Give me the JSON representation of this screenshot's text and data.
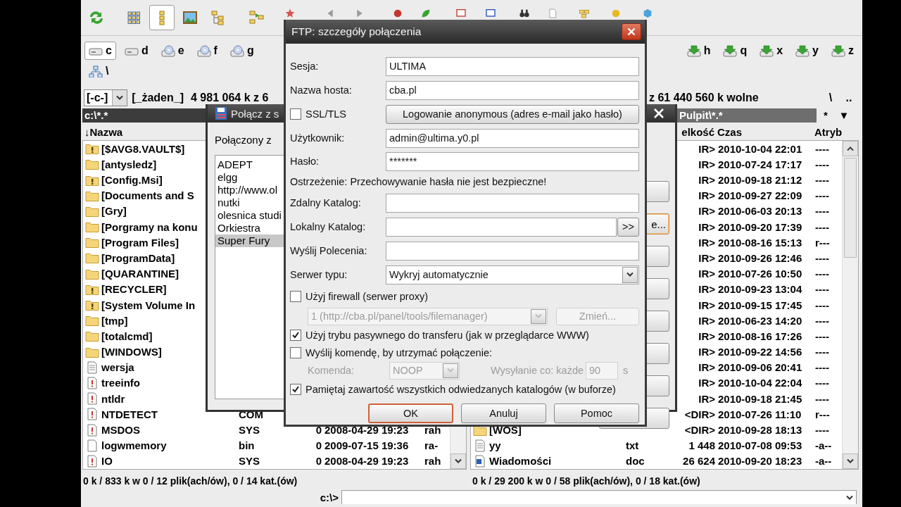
{
  "toolbar": {
    "buttons": [
      {
        "selected": false
      },
      {
        "selected": false
      },
      {
        "selected": true
      },
      {
        "selected": false
      },
      {
        "selected": false
      },
      {
        "selected": false
      },
      {
        "selected": false
      },
      {
        "selected": false
      },
      {
        "selected": false
      },
      {
        "selected": false
      },
      {
        "selected": false
      },
      {
        "selected": false
      },
      {
        "selected": false
      },
      {
        "selected": false
      },
      {
        "selected": false
      },
      {
        "selected": false
      },
      {
        "selected": false
      },
      {
        "selected": false
      }
    ]
  },
  "drives": {
    "left": [
      {
        "letter": "c",
        "kind": "disk",
        "selected": true
      },
      {
        "letter": "d",
        "kind": "disk",
        "selected": false
      },
      {
        "letter": "e",
        "kind": "cd",
        "selected": false
      },
      {
        "letter": "f",
        "kind": "cd",
        "selected": false
      },
      {
        "letter": "g",
        "kind": "cd",
        "selected": false
      }
    ],
    "right": [
      {
        "letter": "h",
        "kind": "net",
        "selected": false
      },
      {
        "letter": "q",
        "kind": "net",
        "selected": false
      },
      {
        "letter": "x",
        "kind": "net",
        "selected": false
      },
      {
        "letter": "y",
        "kind": "net",
        "selected": false
      },
      {
        "letter": "z",
        "kind": "net",
        "selected": false
      }
    ],
    "network": {
      "letter": "\\",
      "kind": "network",
      "selected": false
    }
  },
  "left_panel": {
    "drive_combo": "[-c-]",
    "volume": "[_żaden_]",
    "space": "4 981 064 k z 6",
    "path": "c:\\*.*",
    "columns": [
      "↓Nazwa"
    ],
    "rows": [
      {
        "name": "[$AVG8.VAULT$]",
        "kind": "folder-alert"
      },
      {
        "name": "[antysledz]",
        "kind": "folder"
      },
      {
        "name": "[Config.Msi]",
        "kind": "folder-alert"
      },
      {
        "name": "[Documents and S",
        "kind": "folder"
      },
      {
        "name": "[Gry]",
        "kind": "folder"
      },
      {
        "name": "[Porgramy na konu",
        "kind": "folder"
      },
      {
        "name": "[Program Files]",
        "kind": "folder"
      },
      {
        "name": "[ProgramData]",
        "kind": "folder"
      },
      {
        "name": "[QUARANTINE]",
        "kind": "folder"
      },
      {
        "name": "[RECYCLER]",
        "kind": "folder-alert"
      },
      {
        "name": "[System Volume In",
        "kind": "folder-alert"
      },
      {
        "name": "[tmp]",
        "kind": "folder"
      },
      {
        "name": "[totalcmd]",
        "kind": "folder"
      },
      {
        "name": "[WINDOWS]",
        "kind": "folder"
      },
      {
        "name": "wersja",
        "kind": "text"
      },
      {
        "name": "treeinfo",
        "kind": "system"
      },
      {
        "name": "ntldr",
        "kind": "system"
      },
      {
        "name": "NTDETECT",
        "kind": "system",
        "ext": "COM"
      },
      {
        "name": "MSDOS",
        "kind": "system",
        "ext": "SYS",
        "size": "0",
        "time": "2008-04-29 19:23",
        "attr": "rah"
      },
      {
        "name": "logwmemory",
        "kind": "file",
        "ext": "bin",
        "size": "0",
        "time": "2009-07-15 19:36",
        "attr": "ra-"
      },
      {
        "name": "IO",
        "kind": "system",
        "ext": "SYS",
        "size": "0",
        "time": "2008-04-29 19:23",
        "attr": "rah"
      }
    ],
    "status": "0 k / 833 k w 0 / 12 plik(ach/ów), 0 / 14 kat.(ów)"
  },
  "right_panel": {
    "space": "z 61 440 560 k wolne",
    "root_button": "\\",
    "up_button": "..",
    "path": "Pulpit\\*.*",
    "star_button": "*",
    "menu_button": "▼",
    "columns": [
      "elkość",
      "Czas",
      "Atryb"
    ],
    "rows": [
      {
        "size": "IR>",
        "time": "2010-10-04 22:01",
        "attr": "----"
      },
      {
        "size": "IR>",
        "time": "2010-07-24 17:17",
        "attr": "----"
      },
      {
        "size": "IR>",
        "time": "2010-09-18 21:12",
        "attr": "----"
      },
      {
        "size": "IR>",
        "time": "2010-09-27 22:09",
        "attr": "----"
      },
      {
        "size": "IR>",
        "time": "2010-06-03 20:13",
        "attr": "----"
      },
      {
        "size": "IR>",
        "time": "2010-09-20 17:39",
        "attr": "----"
      },
      {
        "size": "IR>",
        "time": "2010-08-16 15:13",
        "attr": "r---"
      },
      {
        "size": "IR>",
        "time": "2010-09-26 12:46",
        "attr": "----"
      },
      {
        "size": "IR>",
        "time": "2010-07-26 10:50",
        "attr": "----"
      },
      {
        "size": "IR>",
        "time": "2010-09-23 13:04",
        "attr": "----"
      },
      {
        "size": "IR>",
        "time": "2010-09-15 17:45",
        "attr": "----"
      },
      {
        "size": "IR>",
        "time": "2010-06-23 14:20",
        "attr": "----"
      },
      {
        "size": "IR>",
        "time": "2010-08-16 17:26",
        "attr": "----"
      },
      {
        "size": "IR>",
        "time": "2010-09-22 14:56",
        "attr": "----"
      },
      {
        "size": "IR>",
        "time": "2010-09-06 20:41",
        "attr": "----"
      },
      {
        "size": "IR>",
        "time": "2010-10-04 22:04",
        "attr": "----"
      },
      {
        "size": "IR>",
        "time": "2010-09-18 21:45",
        "attr": "----"
      },
      {
        "size": "<DIR>",
        "time": "2010-07-26 11:10",
        "attr": "r---"
      },
      {
        "name": "[WOS]",
        "kind": "folder",
        "size": "<DIR>",
        "time": "2010-09-28 18:13",
        "attr": "----"
      },
      {
        "name": "yy",
        "kind": "text",
        "ext": "txt",
        "size": "1 448",
        "time": "2010-07-08 09:53",
        "attr": "-a--"
      },
      {
        "name": "Wiadomości",
        "kind": "doc",
        "ext": "doc",
        "size": "26 624",
        "time": "2010-09-20 18:23",
        "attr": "-a--"
      }
    ],
    "status": "0 k / 29 200 k w 0 / 58 plik(ach/ów), 0 / 18 kat.(ów)"
  },
  "command_line": {
    "prompt": "c:\\>"
  },
  "connect_dialog": {
    "title": "Połącz z s",
    "list_label": "Połączony z",
    "items": [
      {
        "label": "ADEPT",
        "selected": false
      },
      {
        "label": "elgg",
        "selected": false
      },
      {
        "label": "http://www.ol",
        "selected": false
      },
      {
        "label": "nutki",
        "selected": false
      },
      {
        "label": "olesnica studi",
        "selected": false
      },
      {
        "label": "Orkiestra",
        "selected": false
      },
      {
        "label": "Super Fury",
        "selected": true
      }
    ],
    "side_buttons": [
      {
        "highlighted": false
      },
      {
        "label": "e...",
        "highlighted": true
      },
      {
        "highlighted": false
      },
      {
        "highlighted": false
      },
      {
        "highlighted": false
      },
      {
        "highlighted": false
      },
      {
        "highlighted": false
      },
      {
        "highlighted": false
      }
    ]
  },
  "ftp_dialog": {
    "title": "FTP: szczegóły połączenia",
    "session": {
      "label": "Sesja:",
      "value": "ULTIMA"
    },
    "host": {
      "label": "Nazwa hosta:",
      "value": "cba.pl"
    },
    "ssl": {
      "label": "SSL/TLS",
      "checked": false
    },
    "anonymous_button": "Logowanie anonymous (adres e-mail jako hasło)",
    "user": {
      "label": "Użytkownik:",
      "value": "admin@ultima.y0.pl"
    },
    "password": {
      "label": "Hasło:",
      "value": "*******"
    },
    "warning": "Ostrzeżenie: Przechowywanie hasła nie jest bezpieczne!",
    "remote_dir": {
      "label": "Zdalny Katalog:"
    },
    "local_dir": {
      "label": "Lokalny Katalog:",
      "button": ">>"
    },
    "commands": {
      "label": "Wyślij Polecenia:"
    },
    "server_type": {
      "label": "Serwer typu:",
      "value": "Wykryj automatycznie"
    },
    "firewall": {
      "label": "Użyj firewall (serwer proxy)",
      "checked": false
    },
    "proxy": {
      "value": "1 (http://cba.pl/panel/tools/filemanager)",
      "button": "Zmień...",
      "disabled": true
    },
    "passive": {
      "label": "Użyj trybu pasywnego do transferu (jak w przeglądarce WWW)",
      "checked": true
    },
    "keepalive": {
      "label": "Wyślij komendę, by utrzymać połączenie:",
      "checked": false
    },
    "keepalive_command": {
      "label": "Komenda:",
      "value": "NOOP",
      "interval_label": "Wysyłanie co: każde",
      "interval": "90",
      "unit": "s",
      "disabled": true
    },
    "cache": {
      "label": "Pamiętaj zawartość wszystkich odwiedzanych katalogów (w buforze)",
      "checked": true
    },
    "buttons": [
      {
        "label": "OK",
        "default": true
      },
      {
        "label": "Anuluj",
        "default": false
      },
      {
        "label": "Pomoc",
        "default": false
      }
    ]
  }
}
